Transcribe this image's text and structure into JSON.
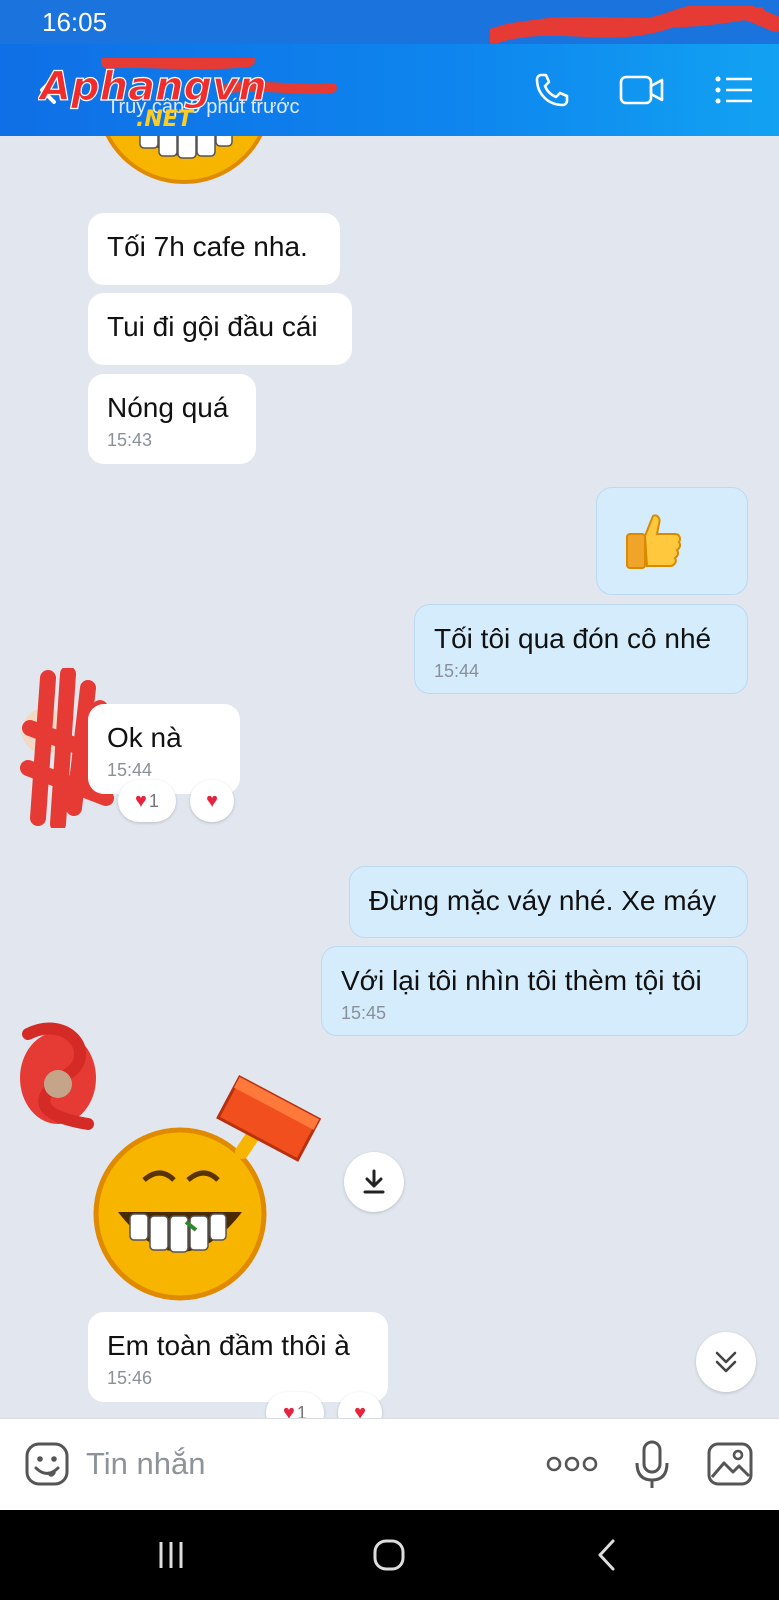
{
  "status_bar": {
    "time": "16:05"
  },
  "header": {
    "logo_text": "Aphangvn",
    "logo_subtext": ".NET",
    "subtitle": "Truy cập 9 phút trước"
  },
  "messages": [
    {
      "direction": "in",
      "text": "Tối 7h cafe nha."
    },
    {
      "direction": "in",
      "text": "Tui đi gội đầu cái"
    },
    {
      "direction": "in",
      "text": "Nóng quá",
      "time": "15:43"
    },
    {
      "direction": "out",
      "sticker": "thumbs-up"
    },
    {
      "direction": "out",
      "text": "Tối tôi qua đón cô nhé",
      "time": "15:44"
    },
    {
      "direction": "in",
      "text": "Ok nà",
      "time": "15:44",
      "reaction_count": "1"
    },
    {
      "direction": "out",
      "text": "Đừng mặc váy nhé. Xe máy"
    },
    {
      "direction": "out",
      "text": "Với lại tôi nhìn tôi thèm tội tôi",
      "time": "15:45"
    },
    {
      "direction": "in",
      "sticker": "grinning-emoji-with-brick"
    },
    {
      "direction": "in",
      "text": "Em toàn đầm thôi à",
      "time": "15:46",
      "reaction_count": "1"
    }
  ],
  "input": {
    "placeholder": "Tin nhắn"
  },
  "colors": {
    "header": "#0e86ee",
    "outgoing_bubble": "#d5ecfc",
    "incoming_bubble": "#ffffff",
    "chat_bg": "#e2e7ef",
    "heart": "#e8233d"
  }
}
